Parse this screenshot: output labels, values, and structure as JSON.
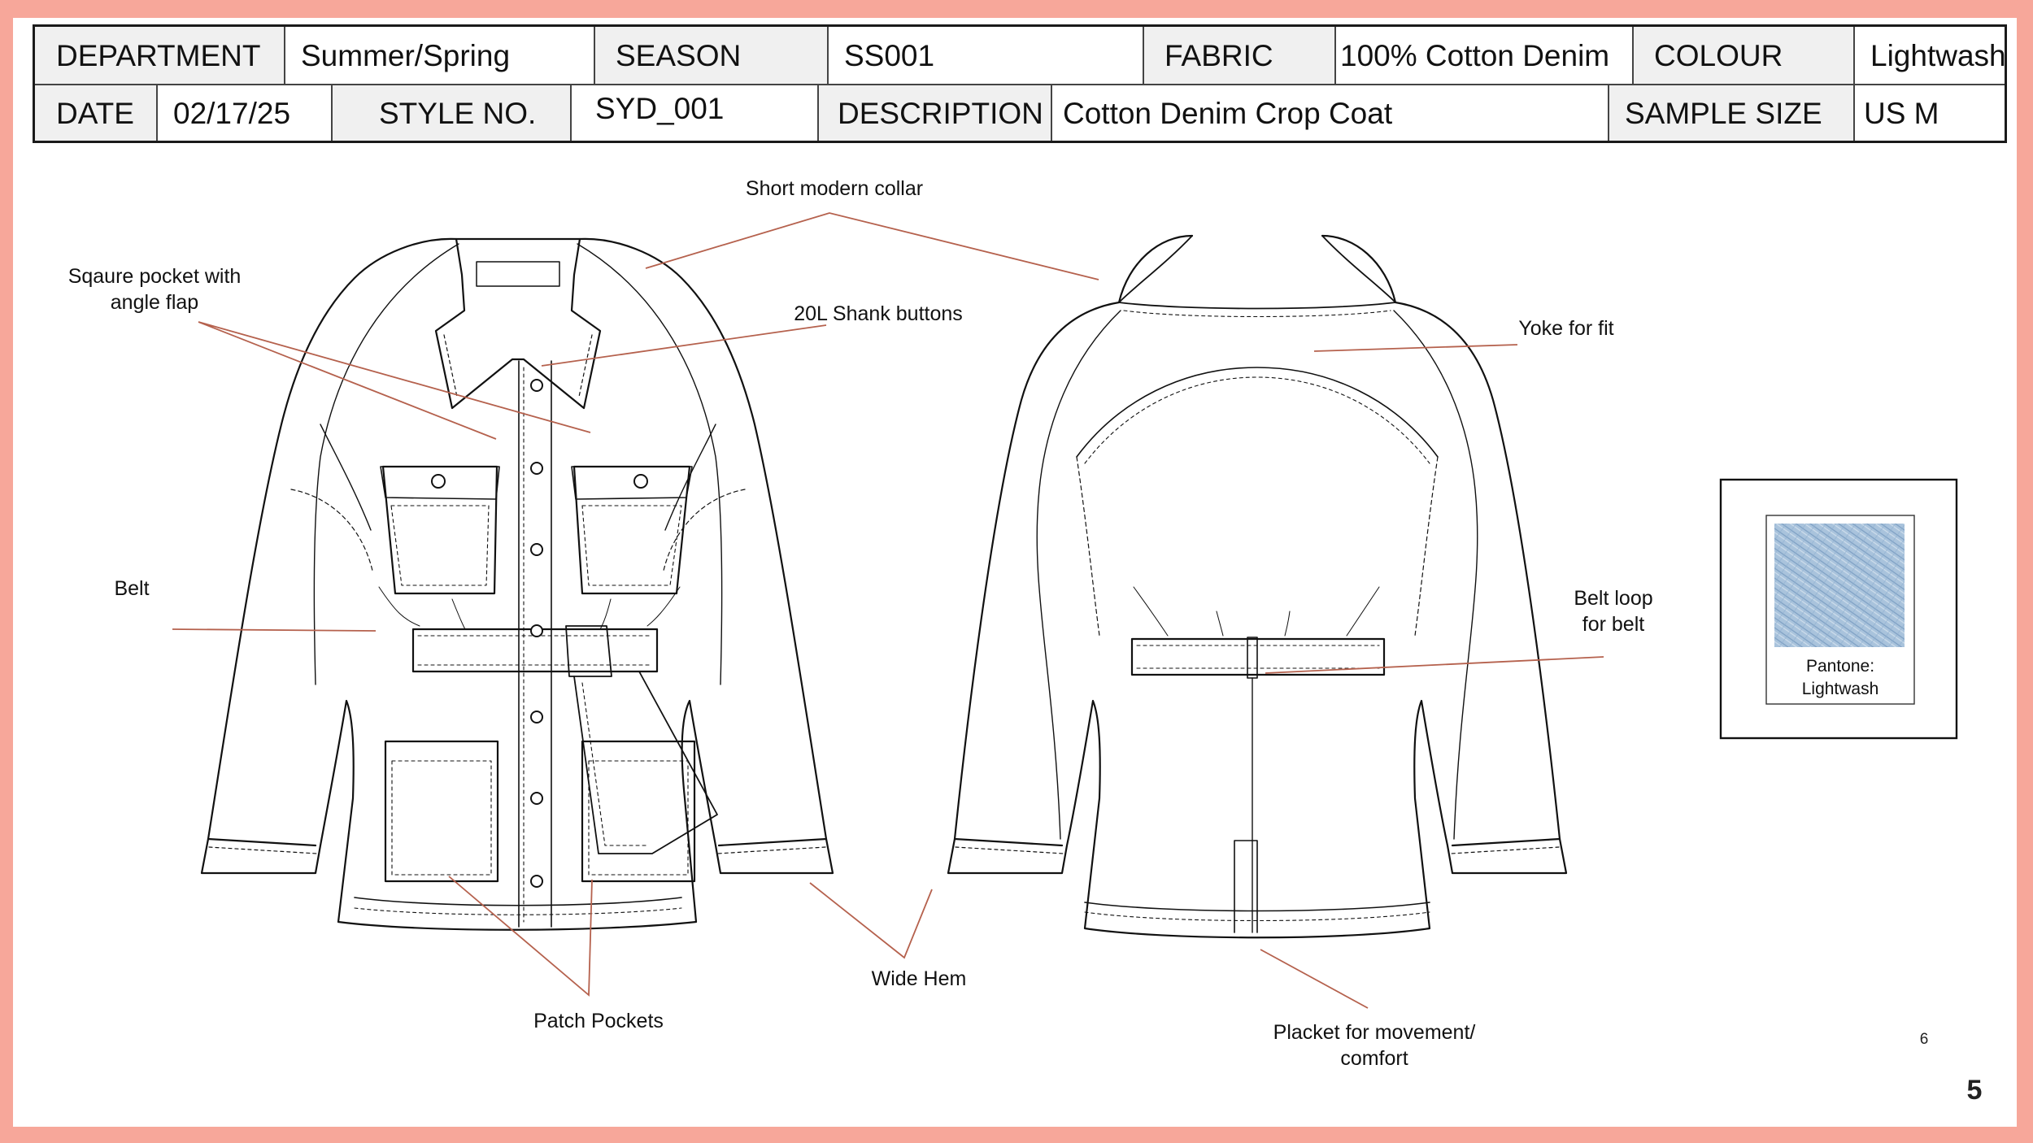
{
  "spec_sheet": {
    "department_label": "DEPARTMENT",
    "department_value": "Summer/Spring",
    "season_label": "SEASON",
    "season_value": "SS001",
    "fabric_label": "FABRIC",
    "fabric_value": "100% Cotton Denim",
    "colour_label": "COLOUR",
    "colour_value": "Lightwash",
    "date_label": "DATE",
    "date_value": "02/17/25",
    "style_label": "STYLE NO.",
    "style_value": "SYD_001",
    "description_label": "DESCRIPTION",
    "description_value": "Cotton Denim Crop Coat",
    "sample_size_label": "SAMPLE SIZE",
    "sample_size_value": "US M"
  },
  "annotations": {
    "collar": "Short modern collar",
    "pocket_line1": "Sqaure pocket with",
    "pocket_line2": "angle flap",
    "buttons": "20L Shank buttons",
    "yoke": "Yoke for fit",
    "belt": "Belt",
    "belt_loop_line1": "Belt loop",
    "belt_loop_line2": "for belt",
    "patch_pockets": "Patch Pockets",
    "wide_hem": "Wide Hem",
    "placket_line1": "Placket for movement/",
    "placket_line2": "comfort"
  },
  "swatch": {
    "label_line1": "Pantone:",
    "label_line2": "Lightwash",
    "denim_color": "#a9c3dc"
  },
  "colors": {
    "border": "#f7a79a",
    "leader_line": "#b5614d"
  },
  "small_page_number": "6",
  "page_number": "5"
}
